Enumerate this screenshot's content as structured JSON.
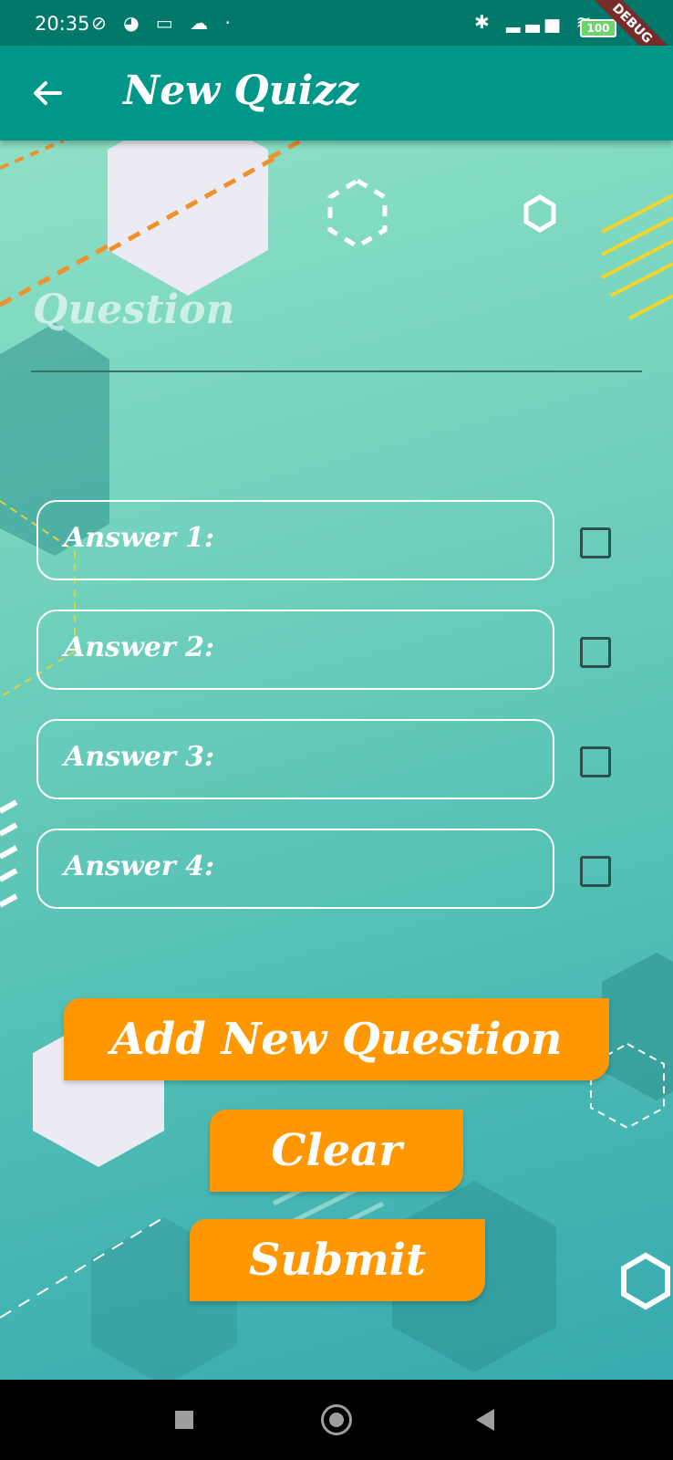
{
  "status_bar": {
    "time": "20:35",
    "left_icons": "⊘ ◕ ▭ ☁ ·",
    "right_icons": "✱ ▂▃▅ ≋",
    "battery": "100",
    "debug_banner": "DEBUG"
  },
  "app_bar": {
    "title": "New Quizz",
    "back_icon": "arrow-left-icon"
  },
  "form": {
    "question_label": "Question",
    "question_value": "",
    "answers": [
      {
        "label": "Answer 1:",
        "checked": false
      },
      {
        "label": "Answer 2:",
        "checked": false
      },
      {
        "label": "Answer 3:",
        "checked": false
      },
      {
        "label": "Answer 4:",
        "checked": false
      }
    ]
  },
  "buttons": {
    "add_new_question": "Add New Question",
    "clear": "Clear",
    "submit": "Submit"
  },
  "colors": {
    "app_bar": "#009688",
    "status_bar": "#00796b",
    "button": "#ff9800"
  },
  "nav_bar": {
    "recents_icon": "square-icon",
    "home_icon": "circle-icon",
    "back_icon": "triangle-back-icon"
  }
}
